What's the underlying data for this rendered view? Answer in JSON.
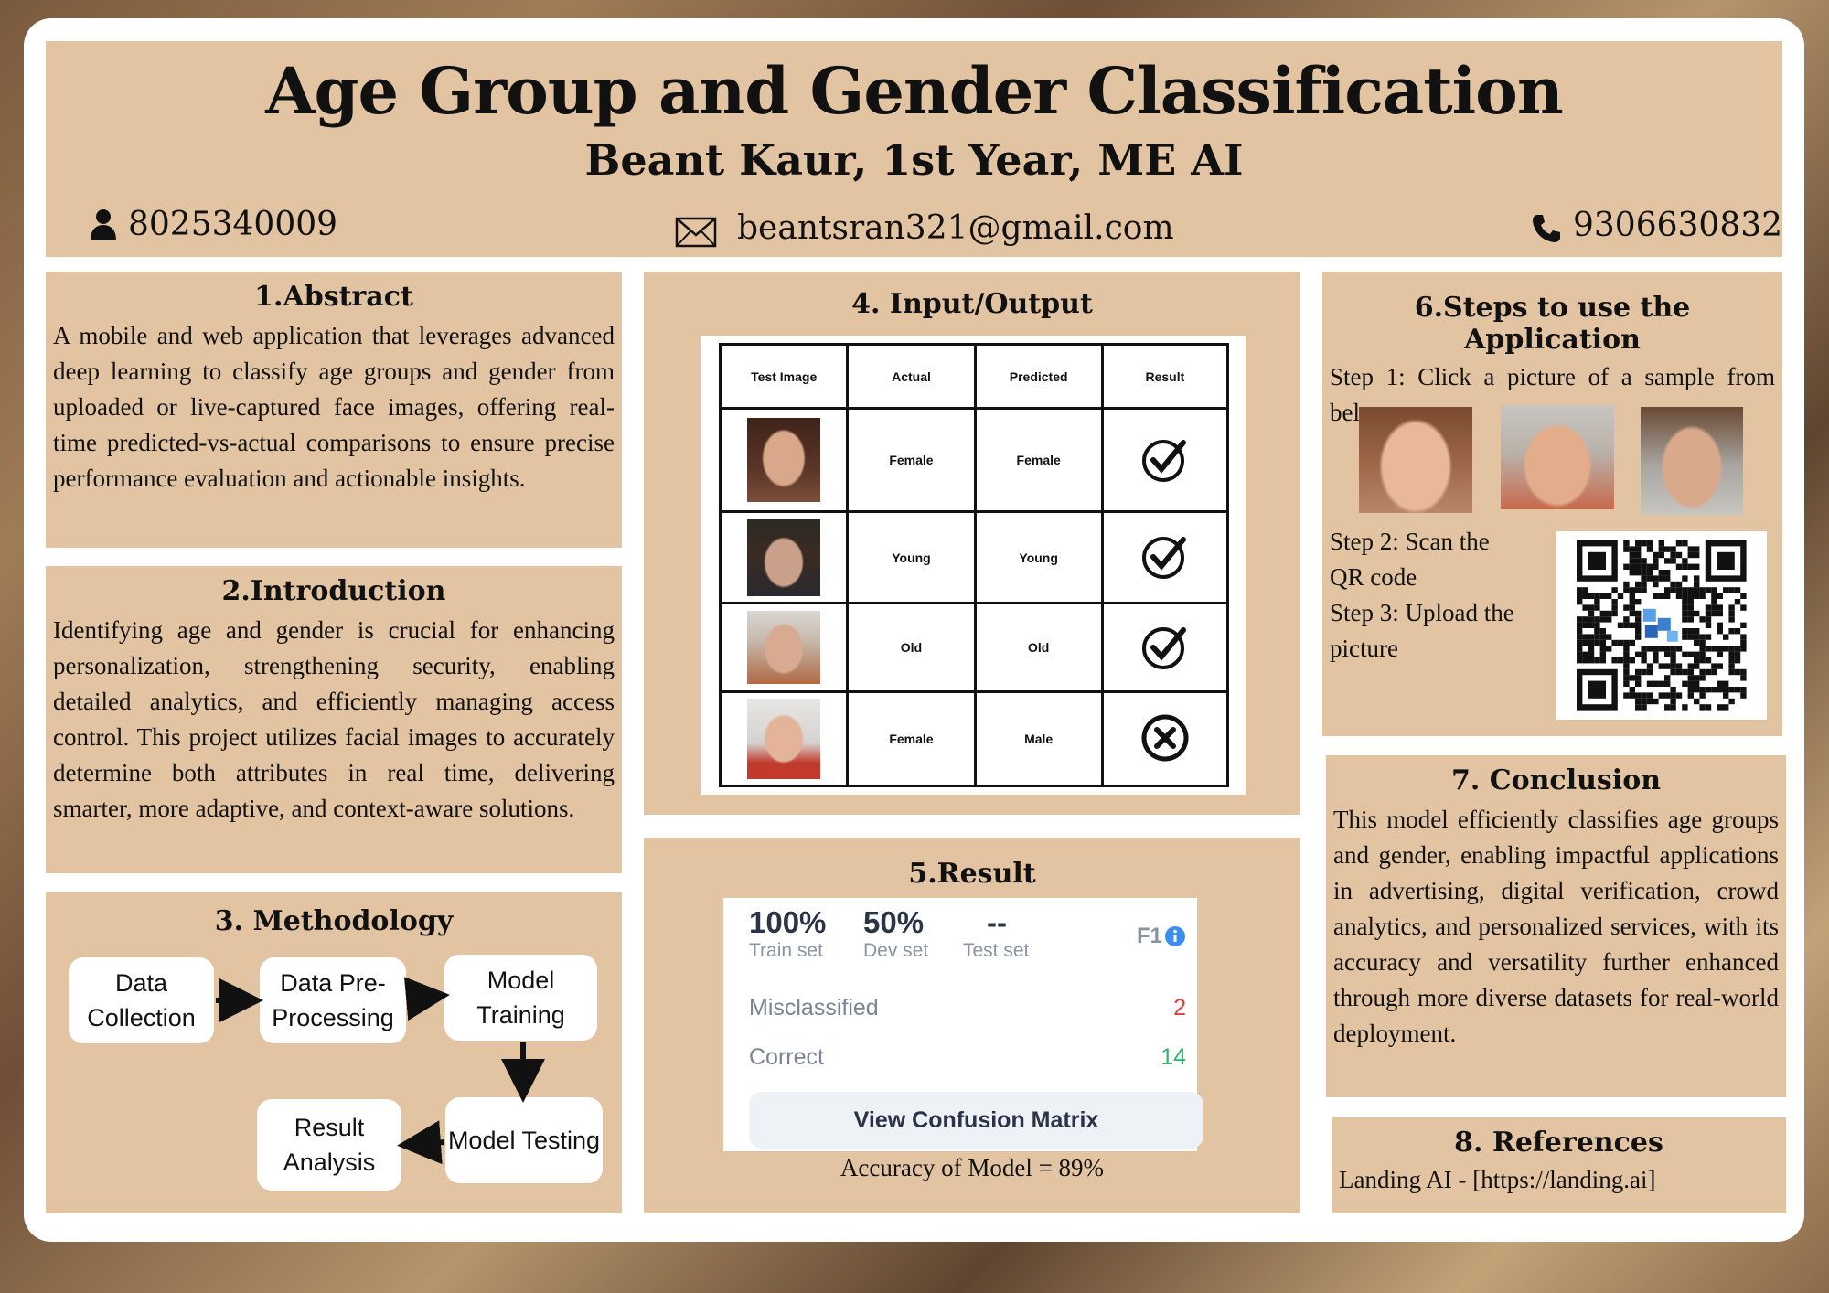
{
  "header": {
    "title": "Age Group and Gender Classification",
    "subtitle": "Beant Kaur, 1st Year, ME AI",
    "contacts": {
      "user_phone": "8025340009",
      "email": "beantsran321@gmail.com",
      "phone": "9306630832"
    },
    "icons": [
      "person-icon",
      "envelope-icon",
      "phone-icon"
    ]
  },
  "abstract": {
    "title": "1.Abstract",
    "text": "A mobile and web application that leverages advanced deep learning to classify age groups and gender from uploaded or live-captured face images, offering real-time predicted-vs-actual comparisons to ensure precise performance evaluation and actionable insights."
  },
  "introduction": {
    "title": "2.Introduction",
    "text": "Identifying age and gender is crucial for enhancing personalization, strengthening security, enabling detailed analytics, and efficiently managing access control. This project utilizes facial images to accurately determine both attributes in real time, delivering smarter, more adaptive, and context-aware solutions."
  },
  "methodology": {
    "title": "3. Methodology",
    "steps": [
      "Data Collection",
      "Data Pre-Processing",
      "Model Training",
      "Model Testing",
      "Result Analysis"
    ]
  },
  "io": {
    "title": "4. Input/Output",
    "headers": [
      "Test Image",
      "Actual",
      "Predicted",
      "Result"
    ],
    "rows": [
      {
        "actual": "Female",
        "predicted": "Female",
        "result": "correct"
      },
      {
        "actual": "Young",
        "predicted": "Young",
        "result": "correct"
      },
      {
        "actual": "Old",
        "predicted": "Old",
        "result": "correct"
      },
      {
        "actual": "Female",
        "predicted": "Male",
        "result": "incorrect"
      }
    ]
  },
  "result": {
    "title": "5.Result",
    "metrics": [
      {
        "value": "100%",
        "label": "Train set"
      },
      {
        "value": "50%",
        "label": "Dev set"
      },
      {
        "value": "--",
        "label": "Test set"
      }
    ],
    "f1_label": "F1",
    "misclassified_label": "Misclassified",
    "misclassified_value": "2",
    "correct_label": "Correct",
    "correct_value": "14",
    "button_label": "View Confusion Matrix",
    "accuracy": "Accuracy of Model = 89%",
    "colors": {
      "misclassified": "#e0403a",
      "correct": "#2fb36d",
      "info": "#3b8ef0"
    }
  },
  "steps": {
    "title": "6.Steps to use the Application",
    "step1": "Step 1: Click a picture of a sample from below:",
    "step2": "Step 2: Scan the QR code",
    "step3": "Step 3: Upload the picture"
  },
  "conclusion": {
    "title": "7. Conclusion",
    "text": "This model efficiently classifies age groups and gender, enabling impactful applications in advertising, digital verification, crowd analytics, and personalized services, with its accuracy and versatility further enhanced through more diverse datasets for real-world deployment."
  },
  "references": {
    "title": "8. References",
    "text": "Landing AI - [https://landing.ai]"
  },
  "colors": {
    "panel": "#e2c4a2",
    "frame": "#ffffff"
  }
}
